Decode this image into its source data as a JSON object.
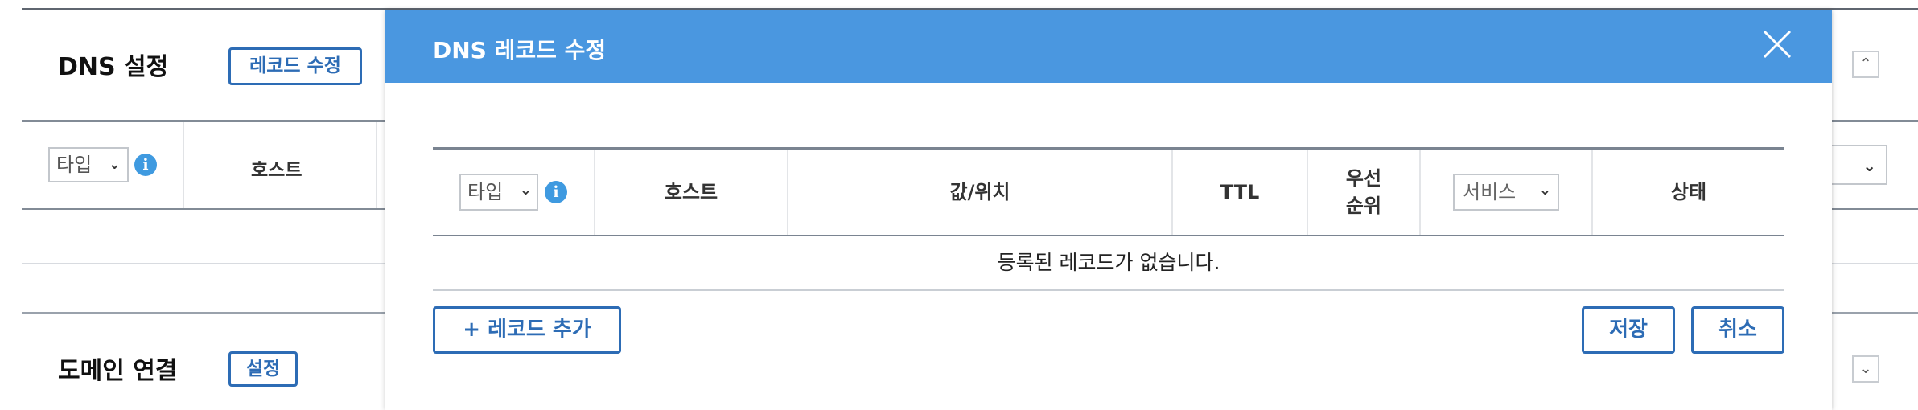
{
  "background": {
    "dns_section_title": "DNS 설정",
    "edit_record_button": "레코드 수정",
    "table_headers": {
      "type_select": "타입",
      "host": "호스트"
    },
    "domain_section_title": "도메인 연결",
    "settings_button": "설정",
    "collapse_up_icon": "⌃",
    "collapse_down_icon": "⌄"
  },
  "modal": {
    "title": "DNS 레코드 수정",
    "close_icon": "close-icon",
    "table": {
      "type_select": "타입",
      "info_icon": "i",
      "host": "호스트",
      "value_location": "값/위치",
      "ttl": "TTL",
      "priority": "우선\n순위",
      "service_select": "서비스",
      "status": "상태"
    },
    "empty_message": "등록된 레코드가 없습니다.",
    "add_record_button": "+ 레코드 추가",
    "save_button": "저장",
    "cancel_button": "취소"
  },
  "colors": {
    "modal_header": "#4a97e0",
    "accent_button": "#2d6cb5",
    "info_icon": "#3f9ae0"
  }
}
